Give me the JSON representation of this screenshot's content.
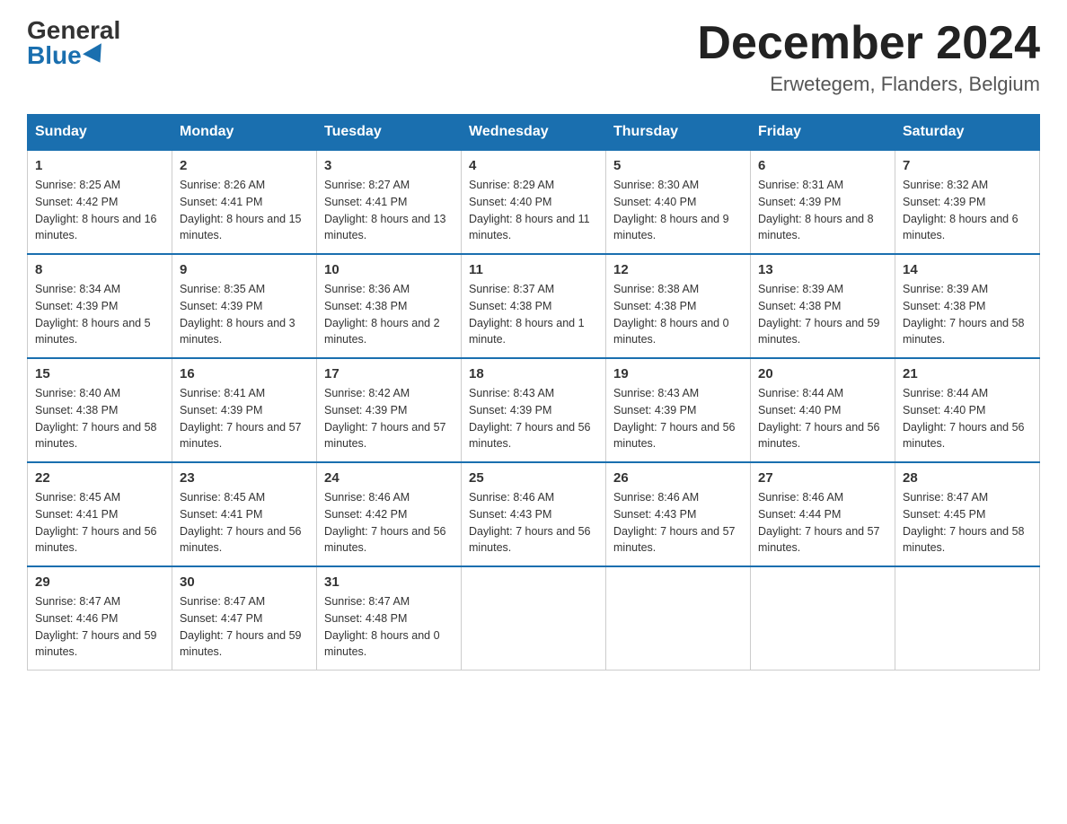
{
  "logo": {
    "general": "General",
    "blue": "Blue"
  },
  "title": "December 2024",
  "location": "Erwetegem, Flanders, Belgium",
  "headers": [
    "Sunday",
    "Monday",
    "Tuesday",
    "Wednesday",
    "Thursday",
    "Friday",
    "Saturday"
  ],
  "weeks": [
    [
      {
        "day": "1",
        "sunrise": "8:25 AM",
        "sunset": "4:42 PM",
        "daylight": "8 hours and 16 minutes."
      },
      {
        "day": "2",
        "sunrise": "8:26 AM",
        "sunset": "4:41 PM",
        "daylight": "8 hours and 15 minutes."
      },
      {
        "day": "3",
        "sunrise": "8:27 AM",
        "sunset": "4:41 PM",
        "daylight": "8 hours and 13 minutes."
      },
      {
        "day": "4",
        "sunrise": "8:29 AM",
        "sunset": "4:40 PM",
        "daylight": "8 hours and 11 minutes."
      },
      {
        "day": "5",
        "sunrise": "8:30 AM",
        "sunset": "4:40 PM",
        "daylight": "8 hours and 9 minutes."
      },
      {
        "day": "6",
        "sunrise": "8:31 AM",
        "sunset": "4:39 PM",
        "daylight": "8 hours and 8 minutes."
      },
      {
        "day": "7",
        "sunrise": "8:32 AM",
        "sunset": "4:39 PM",
        "daylight": "8 hours and 6 minutes."
      }
    ],
    [
      {
        "day": "8",
        "sunrise": "8:34 AM",
        "sunset": "4:39 PM",
        "daylight": "8 hours and 5 minutes."
      },
      {
        "day": "9",
        "sunrise": "8:35 AM",
        "sunset": "4:39 PM",
        "daylight": "8 hours and 3 minutes."
      },
      {
        "day": "10",
        "sunrise": "8:36 AM",
        "sunset": "4:38 PM",
        "daylight": "8 hours and 2 minutes."
      },
      {
        "day": "11",
        "sunrise": "8:37 AM",
        "sunset": "4:38 PM",
        "daylight": "8 hours and 1 minute."
      },
      {
        "day": "12",
        "sunrise": "8:38 AM",
        "sunset": "4:38 PM",
        "daylight": "8 hours and 0 minutes."
      },
      {
        "day": "13",
        "sunrise": "8:39 AM",
        "sunset": "4:38 PM",
        "daylight": "7 hours and 59 minutes."
      },
      {
        "day": "14",
        "sunrise": "8:39 AM",
        "sunset": "4:38 PM",
        "daylight": "7 hours and 58 minutes."
      }
    ],
    [
      {
        "day": "15",
        "sunrise": "8:40 AM",
        "sunset": "4:38 PM",
        "daylight": "7 hours and 58 minutes."
      },
      {
        "day": "16",
        "sunrise": "8:41 AM",
        "sunset": "4:39 PM",
        "daylight": "7 hours and 57 minutes."
      },
      {
        "day": "17",
        "sunrise": "8:42 AM",
        "sunset": "4:39 PM",
        "daylight": "7 hours and 57 minutes."
      },
      {
        "day": "18",
        "sunrise": "8:43 AM",
        "sunset": "4:39 PM",
        "daylight": "7 hours and 56 minutes."
      },
      {
        "day": "19",
        "sunrise": "8:43 AM",
        "sunset": "4:39 PM",
        "daylight": "7 hours and 56 minutes."
      },
      {
        "day": "20",
        "sunrise": "8:44 AM",
        "sunset": "4:40 PM",
        "daylight": "7 hours and 56 minutes."
      },
      {
        "day": "21",
        "sunrise": "8:44 AM",
        "sunset": "4:40 PM",
        "daylight": "7 hours and 56 minutes."
      }
    ],
    [
      {
        "day": "22",
        "sunrise": "8:45 AM",
        "sunset": "4:41 PM",
        "daylight": "7 hours and 56 minutes."
      },
      {
        "day": "23",
        "sunrise": "8:45 AM",
        "sunset": "4:41 PM",
        "daylight": "7 hours and 56 minutes."
      },
      {
        "day": "24",
        "sunrise": "8:46 AM",
        "sunset": "4:42 PM",
        "daylight": "7 hours and 56 minutes."
      },
      {
        "day": "25",
        "sunrise": "8:46 AM",
        "sunset": "4:43 PM",
        "daylight": "7 hours and 56 minutes."
      },
      {
        "day": "26",
        "sunrise": "8:46 AM",
        "sunset": "4:43 PM",
        "daylight": "7 hours and 57 minutes."
      },
      {
        "day": "27",
        "sunrise": "8:46 AM",
        "sunset": "4:44 PM",
        "daylight": "7 hours and 57 minutes."
      },
      {
        "day": "28",
        "sunrise": "8:47 AM",
        "sunset": "4:45 PM",
        "daylight": "7 hours and 58 minutes."
      }
    ],
    [
      {
        "day": "29",
        "sunrise": "8:47 AM",
        "sunset": "4:46 PM",
        "daylight": "7 hours and 59 minutes."
      },
      {
        "day": "30",
        "sunrise": "8:47 AM",
        "sunset": "4:47 PM",
        "daylight": "7 hours and 59 minutes."
      },
      {
        "day": "31",
        "sunrise": "8:47 AM",
        "sunset": "4:48 PM",
        "daylight": "8 hours and 0 minutes."
      },
      null,
      null,
      null,
      null
    ]
  ],
  "labels": {
    "sunrise": "Sunrise:",
    "sunset": "Sunset:",
    "daylight": "Daylight:"
  }
}
